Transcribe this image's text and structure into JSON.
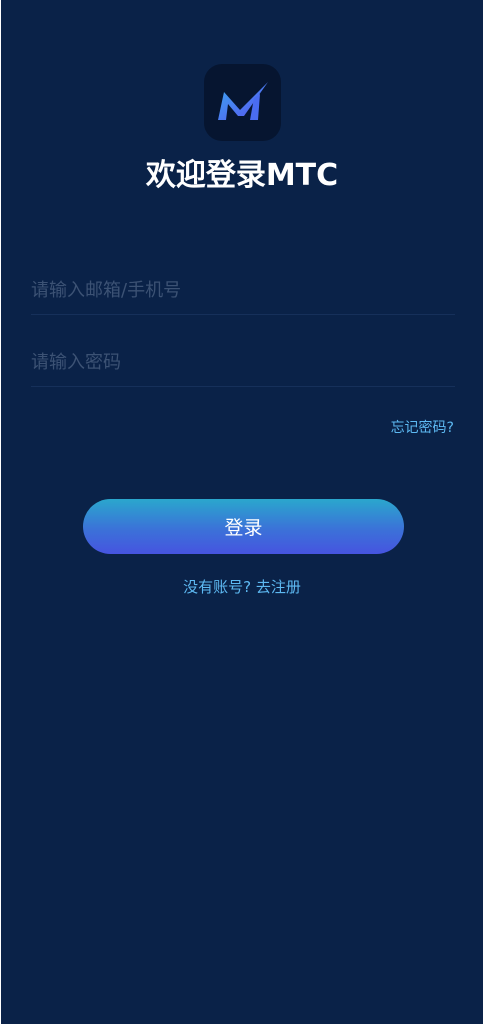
{
  "app": {
    "logo_icon": "mtc-logo-icon",
    "title": "欢迎登录MTC"
  },
  "form": {
    "email_placeholder": "请输入邮箱/手机号",
    "email_value": "",
    "password_placeholder": "请输入密码",
    "password_value": "",
    "forgot_label": "忘记密码?",
    "login_label": "登录",
    "register_label": "没有账号? 去注册"
  },
  "colors": {
    "background": "#0a2248",
    "accent_link": "#5db9f2",
    "button_gradient_top": "#2aa7cd",
    "button_gradient_bottom": "#4654e0"
  }
}
